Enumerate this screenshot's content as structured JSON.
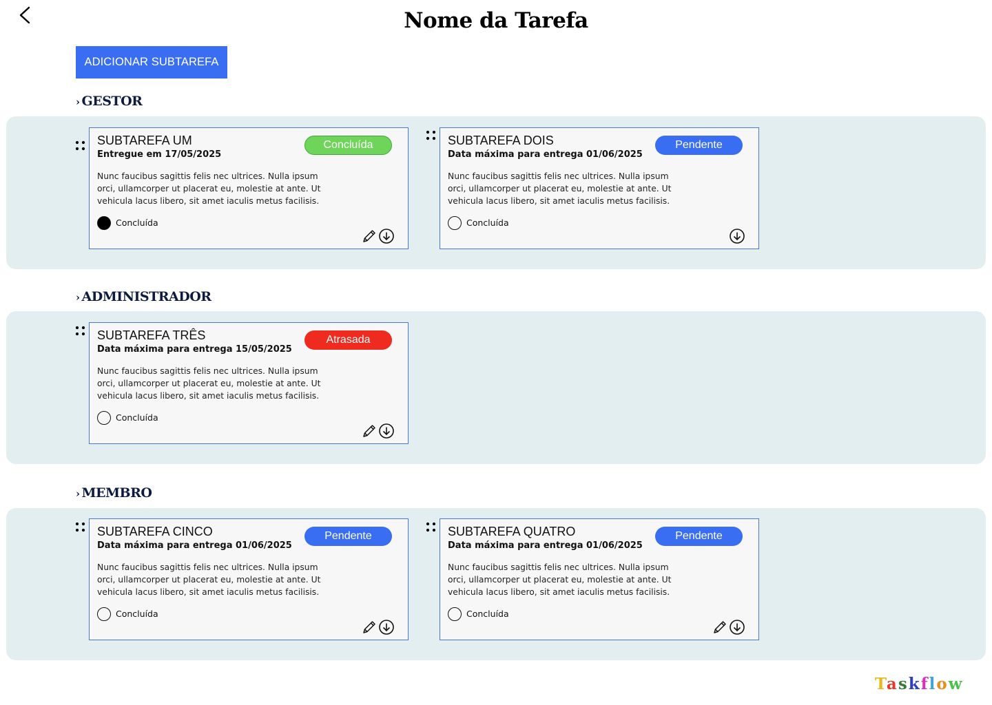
{
  "header": {
    "title": "Nome da Tarefa"
  },
  "toolbar": {
    "add_label": "ADICIONAR SUBTAREFA"
  },
  "colors": {
    "primary": "#3a6ef2",
    "panel": "#e3eef0",
    "done": "#6fd45a",
    "pending": "#3a6ef2",
    "late": "#ef2a1f"
  },
  "sections": [
    {
      "heading": "GESTOR",
      "cards": [
        {
          "title": "SUBTAREFA UM",
          "date": "Entregue em 17/05/2025",
          "status": "Concluída",
          "status_color": "#6fd45a",
          "description": "Nunc faucibus sagittis felis nec ultrices. Nulla ipsum orci, ullamcorper ut placerat eu, molestie at ante. Ut vehicula lacus libero, sit amet iaculis metus facilisis.",
          "done_label": "Concluída",
          "done_checked": true,
          "editable": true
        },
        {
          "title": "SUBTAREFA DOIS",
          "date": "Data máxima para entrega 01/06/2025",
          "status": "Pendente",
          "status_color": "#3a6ef2",
          "description": "Nunc faucibus sagittis felis nec ultrices. Nulla ipsum orci, ullamcorper ut placerat eu, molestie at ante. Ut vehicula lacus libero, sit amet iaculis metus facilisis.",
          "done_label": "Concluída",
          "done_checked": false,
          "editable": false
        }
      ]
    },
    {
      "heading": "ADMINISTRADOR",
      "cards": [
        {
          "title": "SUBTAREFA TRÊS",
          "date": "Data máxima para entrega 15/05/2025",
          "status": "Atrasada",
          "status_color": "#ef2a1f",
          "description": "Nunc faucibus sagittis felis nec ultrices. Nulla ipsum orci, ullamcorper ut placerat eu, molestie at ante. Ut vehicula lacus libero, sit amet iaculis metus facilisis.",
          "done_label": "Concluída",
          "done_checked": false,
          "editable": true
        }
      ]
    },
    {
      "heading": "MEMBRO",
      "cards": [
        {
          "title": "SUBTAREFA CINCO",
          "date": "Data máxima para entrega 01/06/2025",
          "status": "Pendente",
          "status_color": "#3a6ef2",
          "description": "Nunc faucibus sagittis felis nec ultrices. Nulla ipsum orci, ullamcorper ut placerat eu, molestie at ante. Ut vehicula lacus libero, sit amet iaculis metus facilisis.",
          "done_label": "Concluída",
          "done_checked": false,
          "editable": true
        },
        {
          "title": "SUBTAREFA QUATRO",
          "date": "Data máxima para entrega 01/06/2025",
          "status": "Pendente",
          "status_color": "#3a6ef2",
          "description": "Nunc faucibus sagittis felis nec ultrices. Nulla ipsum orci, ullamcorper ut placerat eu, molestie at ante. Ut vehicula lacus libero, sit amet iaculis metus facilisis.",
          "done_label": "Concluída",
          "done_checked": false,
          "editable": true
        }
      ]
    }
  ],
  "brand": {
    "letters": [
      "T",
      "a",
      "s",
      "k",
      "f",
      "l",
      "o",
      "w"
    ],
    "letter_colors": [
      "#e8b81c",
      "#e33a2a",
      "#3a7a3a",
      "#2d3fc0",
      "#e02bbd",
      "#3aa3e3",
      "#f08a1c",
      "#4cc04c"
    ]
  }
}
